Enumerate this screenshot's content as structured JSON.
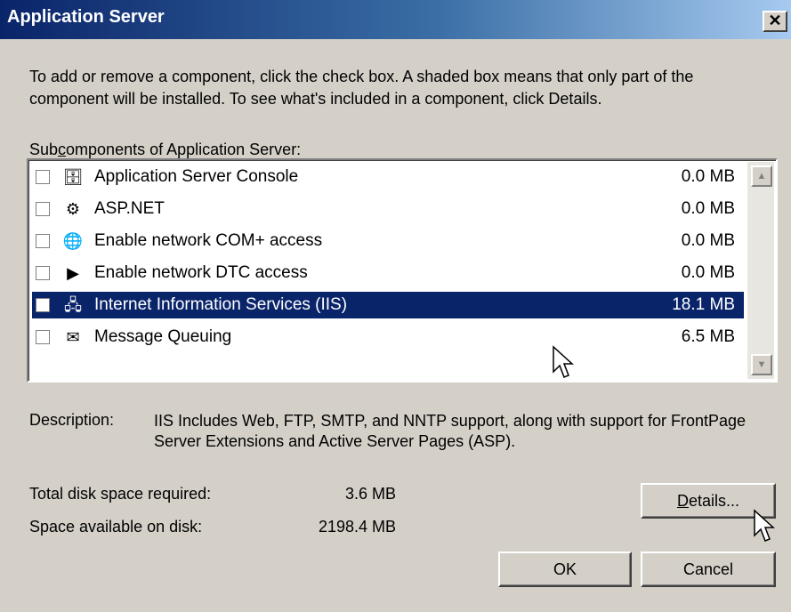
{
  "window": {
    "title": "Application Server",
    "close_label": "✕"
  },
  "instructions": "To add or remove a component, click the check box. A shaded box means that only part of the component will be installed. To see what's included in a component, click Details.",
  "subcomponents_label": {
    "pre": "Sub",
    "accel": "c",
    "post": "omponents of Application Server:"
  },
  "components": [
    {
      "label": "Application Server Console",
      "size": "0.0 MB",
      "icon": "console-icon",
      "checked": false,
      "selected": false
    },
    {
      "label": "ASP.NET",
      "size": "0.0 MB",
      "icon": "gears-icon",
      "checked": false,
      "selected": false
    },
    {
      "label": "Enable network COM+ access",
      "size": "0.0 MB",
      "icon": "globe-icon",
      "checked": false,
      "selected": false
    },
    {
      "label": "Enable network DTC access",
      "size": "0.0 MB",
      "icon": "dtc-icon",
      "checked": false,
      "selected": false
    },
    {
      "label": "Internet Information Services (IIS)",
      "size": "18.1 MB",
      "icon": "iis-icon",
      "checked": false,
      "selected": true
    },
    {
      "label": "Message Queuing",
      "size": "6.5 MB",
      "icon": "envelope-icon",
      "checked": false,
      "selected": false
    }
  ],
  "description": {
    "label": "Description:",
    "text": "IIS Includes Web, FTP, SMTP, and NNTP support, along with support for FrontPage Server Extensions and Active Server Pages (ASP)."
  },
  "disk": {
    "required_label": "Total disk space required:",
    "required_value": "3.6 MB",
    "available_label": "Space available on disk:",
    "available_value": "2198.4 MB"
  },
  "buttons": {
    "details_accel": "D",
    "details_rest": "etails...",
    "ok": "OK",
    "cancel": "Cancel"
  },
  "colors": {
    "title_start": "#0a246a",
    "title_end": "#a6caf0",
    "selection": "#0a246a",
    "face": "#d4d0c8"
  }
}
